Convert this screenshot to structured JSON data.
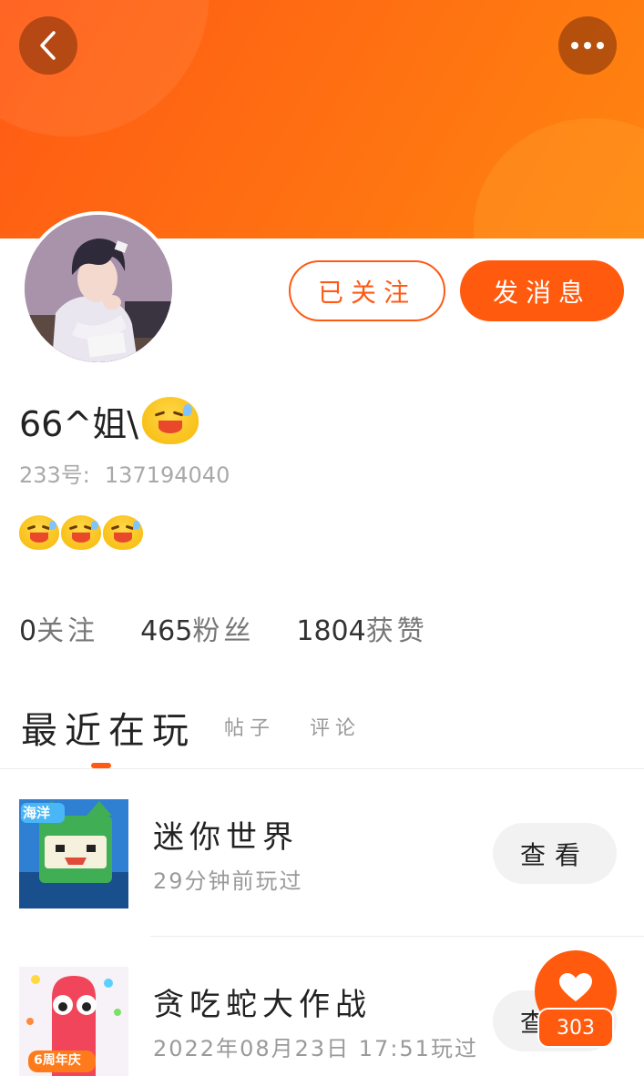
{
  "header": {
    "back_icon": "chevron-left-icon",
    "more_icon": "more-dots-icon",
    "colors": {
      "banner": "#ff6d12",
      "accent": "#ff5a14"
    }
  },
  "profile": {
    "avatar_icon": "avatar-anime-boy",
    "follow_label": "已关注",
    "message_label": "发消息",
    "username": "66^姐\\",
    "uid_label": "233号:",
    "uid_value": "137194040",
    "bio_emojis": [
      "sweat-smile-emoji",
      "sweat-smile-emoji",
      "sweat-smile-emoji"
    ]
  },
  "stats": [
    {
      "value": "0",
      "label": "关注"
    },
    {
      "value": "465",
      "label": "粉丝"
    },
    {
      "value": "1804",
      "label": "获赞"
    }
  ],
  "tabs": [
    {
      "label": "最近在玩",
      "active": true
    },
    {
      "label": "帖子",
      "active": false
    },
    {
      "label": "评论",
      "active": false
    }
  ],
  "games": [
    {
      "name": "迷你世界",
      "time": "29分钟前玩过",
      "action": "查看",
      "icon": "mini-world-icon",
      "badge": "海洋"
    },
    {
      "name": "贪吃蛇大作战",
      "time": "2022年08月23日  17:51玩过",
      "action": "查看",
      "icon": "snake-battle-icon",
      "badge": "6周年庆"
    }
  ],
  "like_fab": {
    "icon": "heart-icon",
    "count": "303"
  }
}
